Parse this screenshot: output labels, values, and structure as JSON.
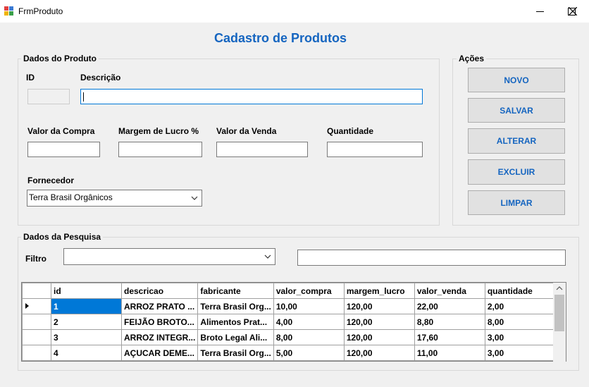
{
  "window": {
    "title": "FrmProduto"
  },
  "form": {
    "title": "Cadastro de Produtos"
  },
  "dados_produto": {
    "legend": "Dados do Produto",
    "id_label": "ID",
    "descricao_label": "Descrição",
    "valor_compra_label": "Valor da Compra",
    "margem_label": "Margem de Lucro %",
    "valor_venda_label": "Valor da Venda",
    "quantidade_label": "Quantidade",
    "fornecedor_label": "Fornecedor",
    "fornecedor_value": "Terra Brasil Orgânicos"
  },
  "acoes": {
    "legend": "Ações",
    "novo": "NOVO",
    "salvar": "SALVAR",
    "alterar": "ALTERAR",
    "excluir": "EXCLUIR",
    "limpar": "LIMPAR"
  },
  "pesquisa": {
    "legend": "Dados da Pesquisa",
    "filtro_label": "Filtro"
  },
  "grid": {
    "columns": [
      "id",
      "descricao",
      "fabricante",
      "valor_compra",
      "margem_lucro",
      "valor_venda",
      "quantidade"
    ],
    "rows": [
      [
        "1",
        "ARROZ PRATO ...",
        "Terra Brasil Org...",
        "10,00",
        "120,00",
        "22,00",
        "2,00"
      ],
      [
        "2",
        "FEIJÃO BROTO...",
        "Alimentos Prat...",
        "4,00",
        "120,00",
        "8,80",
        "8,00"
      ],
      [
        "3",
        "ARROZ INTEGR...",
        "Broto Legal Ali...",
        "8,00",
        "120,00",
        "17,60",
        "3,00"
      ],
      [
        "4",
        "AÇUCAR DEME...",
        "Terra Brasil Org...",
        "5,00",
        "120,00",
        "11,00",
        "3,00"
      ]
    ]
  }
}
